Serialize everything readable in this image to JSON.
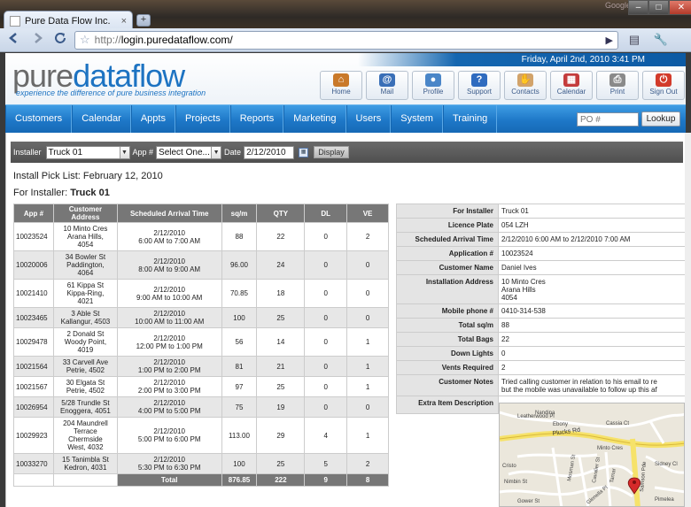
{
  "browser": {
    "tab_title": "Pure Data Flow Inc.",
    "tab_close": "×",
    "new_tab": "+",
    "google_label": "Google",
    "url_scheme": "http://",
    "url_host": "login.puredataflow.com/",
    "win_min": "–",
    "win_max": "□",
    "win_close": "✕"
  },
  "header": {
    "date": "Friday, April 2nd, 2010  3:41 PM",
    "logo_part1": "pure",
    "logo_part2": "dataflow",
    "tagline": "experience the difference of pure business integration",
    "icons": [
      {
        "label": "Home",
        "icon": "home-icon",
        "color": "#c9792a",
        "glyph": "⌂"
      },
      {
        "label": "Mail",
        "icon": "mail-icon",
        "color": "#3a6fb7",
        "glyph": "@"
      },
      {
        "label": "Profile",
        "icon": "profile-icon",
        "color": "#4a86c8",
        "glyph": "●"
      },
      {
        "label": "Support",
        "icon": "support-icon",
        "color": "#2f6bbf",
        "glyph": "?"
      },
      {
        "label": "Contacts",
        "icon": "contacts-icon",
        "color": "#d2a36a",
        "glyph": "✋"
      },
      {
        "label": "Calendar",
        "icon": "calendar-icon",
        "color": "#c43c3c",
        "glyph": "▦"
      },
      {
        "label": "Print",
        "icon": "print-icon",
        "color": "#8a8a8a",
        "glyph": "⎙"
      },
      {
        "label": "Sign Out",
        "icon": "signout-icon",
        "color": "#d23b2b",
        "glyph": "⏻"
      }
    ]
  },
  "nav": {
    "items": [
      "Customers",
      "Calendar",
      "Appts",
      "Projects",
      "Reports",
      "Marketing",
      "Users",
      "System",
      "Training"
    ],
    "po_placeholder": "PO #",
    "lookup_label": "Lookup"
  },
  "filter": {
    "installer_label": "Installer",
    "installer_value": "Truck 01",
    "app_label": "App #",
    "app_value": "Select One...",
    "date_label": "Date",
    "date_value": "2/12/2010",
    "display_label": "Display"
  },
  "picklist": {
    "install_pick_list": "Install Pick List:  February 12, 2010",
    "for_installer_label": "For Installer:",
    "for_installer_value": "Truck 01"
  },
  "jobs": {
    "headers": [
      "App #",
      "Customer Address",
      "Scheduled Arrival Time",
      "sq/m",
      "QTY",
      "DL",
      "VE"
    ],
    "rows": [
      {
        "app": "10023524",
        "address": [
          "10 Minto Cres",
          "Arana Hills,",
          "4054"
        ],
        "arrival": [
          "2/12/2010",
          "6:00 AM to 7:00 AM"
        ],
        "sqm": "88",
        "qty": "22",
        "dl": "0",
        "ve": "2"
      },
      {
        "app": "10020006",
        "address": [
          "34 Bowler St",
          "Paddington,",
          "4064"
        ],
        "arrival": [
          "2/12/2010",
          "8:00 AM to 9:00 AM"
        ],
        "sqm": "96.00",
        "qty": "24",
        "dl": "0",
        "ve": "0"
      },
      {
        "app": "10021410",
        "address": [
          "61 Kippa St",
          "Kippa-Ring,",
          "4021"
        ],
        "arrival": [
          "2/12/2010",
          "9:00 AM to 10:00 AM"
        ],
        "sqm": "70.85",
        "qty": "18",
        "dl": "0",
        "ve": "0"
      },
      {
        "app": "10023465",
        "address": [
          "3 Able St",
          "Kallangur, 4503"
        ],
        "arrival": [
          "2/12/2010",
          "10:00 AM to 11:00 AM"
        ],
        "sqm": "100",
        "qty": "25",
        "dl": "0",
        "ve": "0"
      },
      {
        "app": "10029478",
        "address": [
          "2 Donald St",
          "Woody Point,",
          "4019"
        ],
        "arrival": [
          "2/12/2010",
          "12:00 PM to 1:00 PM"
        ],
        "sqm": "56",
        "qty": "14",
        "dl": "0",
        "ve": "1"
      },
      {
        "app": "10021564",
        "address": [
          "33 Carvell Ave",
          "Petrie, 4502"
        ],
        "arrival": [
          "2/12/2010",
          "1:00 PM to 2:00 PM"
        ],
        "sqm": "81",
        "qty": "21",
        "dl": "0",
        "ve": "1"
      },
      {
        "app": "10021567",
        "address": [
          "30 Elgata St",
          "Petrie, 4502"
        ],
        "arrival": [
          "2/12/2010",
          "2:00 PM to 3:00 PM"
        ],
        "sqm": "97",
        "qty": "25",
        "dl": "0",
        "ve": "1"
      },
      {
        "app": "10026954",
        "address": [
          "5/28 Trundle St",
          "Enoggera, 4051"
        ],
        "arrival": [
          "2/12/2010",
          "4:00 PM to 5:00 PM"
        ],
        "sqm": "75",
        "qty": "19",
        "dl": "0",
        "ve": "0"
      },
      {
        "app": "10029923",
        "address": [
          "204 Maundrell",
          "Terrace",
          "Chermside",
          "West, 4032"
        ],
        "arrival": [
          "2/12/2010",
          "5:00 PM to 6:00 PM"
        ],
        "sqm": "113.00",
        "qty": "29",
        "dl": "4",
        "ve": "1"
      },
      {
        "app": "10033270",
        "address": [
          "15 Tanimbla St",
          "Kedron, 4031"
        ],
        "arrival": [
          "2/12/2010",
          "5:30 PM to 6:30 PM"
        ],
        "sqm": "100",
        "qty": "25",
        "dl": "5",
        "ve": "2"
      }
    ],
    "total": {
      "label": "Total",
      "sqm": "876.85",
      "qty": "222",
      "dl": "9",
      "ve": "8"
    }
  },
  "details": [
    {
      "label": "For Installer",
      "value": [
        "Truck 01"
      ]
    },
    {
      "label": "Licence Plate",
      "value": [
        "054 LZH"
      ]
    },
    {
      "label": "Scheduled Arrival Time",
      "value": [
        "2/12/2010 6:00 AM to 2/12/2010 7:00 AM"
      ]
    },
    {
      "label": "Application #",
      "value": [
        "10023524"
      ]
    },
    {
      "label": "Customer Name",
      "value": [
        "Daniel Ives"
      ]
    },
    {
      "label": "Installation Address",
      "value": [
        "10 Minto Cres",
        "Arana Hills",
        "4054"
      ]
    },
    {
      "label": "Mobile phone #",
      "value": [
        "0410-314-538"
      ]
    },
    {
      "label": "Total sq/m",
      "value": [
        "88"
      ]
    },
    {
      "label": "Total Bags",
      "value": [
        "22"
      ]
    },
    {
      "label": "Down Lights",
      "value": [
        "0"
      ]
    },
    {
      "label": "Vents Required",
      "value": [
        "2"
      ]
    },
    {
      "label": "Customer Notes",
      "value": [
        "Tried calling customer in relation to his email to re",
        "but the mobile was unavailable to follow up this af"
      ]
    },
    {
      "label": "Extra Item Description",
      "value": [
        ""
      ]
    }
  ],
  "map": {
    "streets": [
      "Leatherwood Pl",
      "Plucks Rd",
      "Minto Cres",
      "Cassia Ct",
      "Ebony",
      "Nandina",
      "Mosman St",
      "Cavalier St",
      "Tamar",
      "Sidney Cl",
      "Nimbin St",
      "Gower St",
      "Glenella Pl",
      "Cristo",
      "Samson Pde",
      "Pimelea"
    ]
  }
}
